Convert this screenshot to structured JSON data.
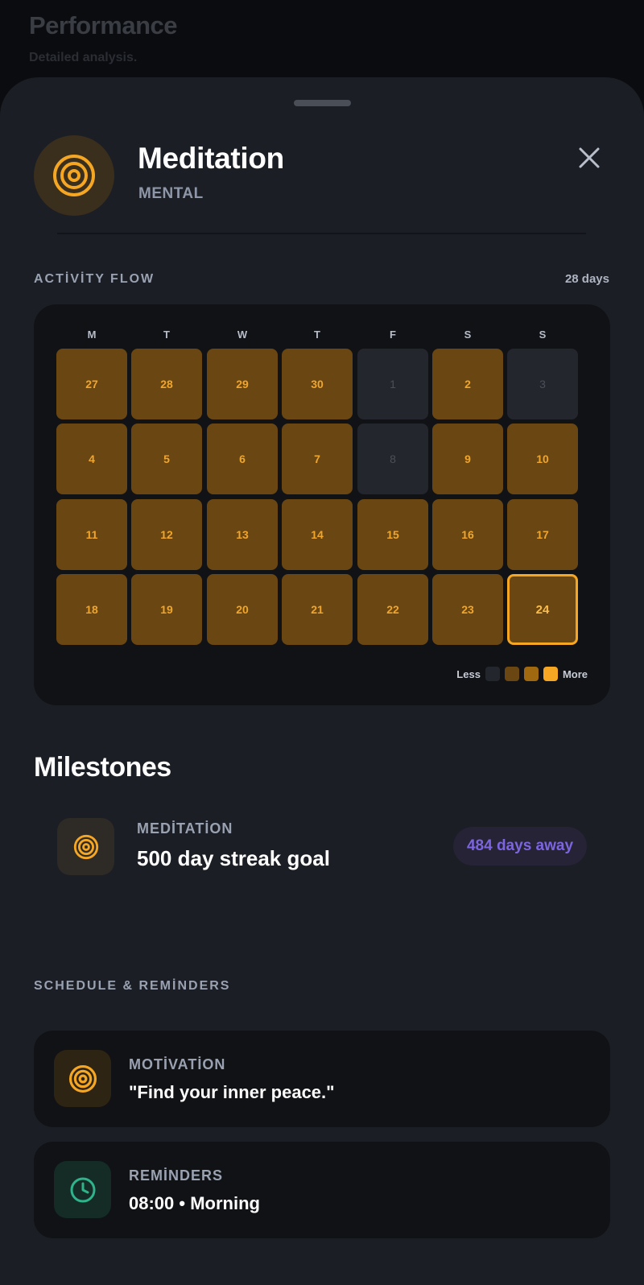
{
  "background": {
    "title": "Performance",
    "subtitle": "Detailed analysis."
  },
  "habit": {
    "title": "Meditation",
    "category": "MENTAL",
    "icon": "target-icon"
  },
  "activity": {
    "label": "ACTİVİTY FLOW",
    "days": "28 days",
    "weekdays": [
      "M",
      "T",
      "W",
      "T",
      "F",
      "S",
      "S"
    ],
    "cells": [
      {
        "d": "27",
        "active": true
      },
      {
        "d": "28",
        "active": true
      },
      {
        "d": "29",
        "active": true
      },
      {
        "d": "30",
        "active": true
      },
      {
        "d": "1",
        "active": false
      },
      {
        "d": "2",
        "active": true
      },
      {
        "d": "3",
        "active": false
      },
      {
        "d": "4",
        "active": true
      },
      {
        "d": "5",
        "active": true
      },
      {
        "d": "6",
        "active": true
      },
      {
        "d": "7",
        "active": true
      },
      {
        "d": "8",
        "active": false
      },
      {
        "d": "9",
        "active": true
      },
      {
        "d": "10",
        "active": true
      },
      {
        "d": "11",
        "active": true
      },
      {
        "d": "12",
        "active": true
      },
      {
        "d": "13",
        "active": true
      },
      {
        "d": "14",
        "active": true
      },
      {
        "d": "15",
        "active": true
      },
      {
        "d": "16",
        "active": true
      },
      {
        "d": "17",
        "active": true
      },
      {
        "d": "18",
        "active": true
      },
      {
        "d": "19",
        "active": true
      },
      {
        "d": "20",
        "active": true
      },
      {
        "d": "21",
        "active": true
      },
      {
        "d": "22",
        "active": true
      },
      {
        "d": "23",
        "active": true
      },
      {
        "d": "24",
        "active": true,
        "today": true
      }
    ],
    "legend": {
      "less": "Less",
      "more": "More",
      "colors": [
        "#24262d",
        "#6a4712",
        "#a0690f",
        "#f5a623"
      ]
    }
  },
  "milestones": {
    "title": "Milestones",
    "item": {
      "category": "MEDİTATİON",
      "text": "500 day streak goal",
      "badge": "484 days away"
    }
  },
  "schedule": {
    "label": "SCHEDULE & REMİNDERS",
    "motivation": {
      "label": "MOTİVATİON",
      "text": "\"Find your inner peace.\""
    },
    "reminders": {
      "label": "REMİNDERS",
      "text": "08:00 • Morning"
    }
  },
  "colors": {
    "accent": "#f5a623",
    "purple": "#7d65e0",
    "teal": "#2fb38a"
  }
}
